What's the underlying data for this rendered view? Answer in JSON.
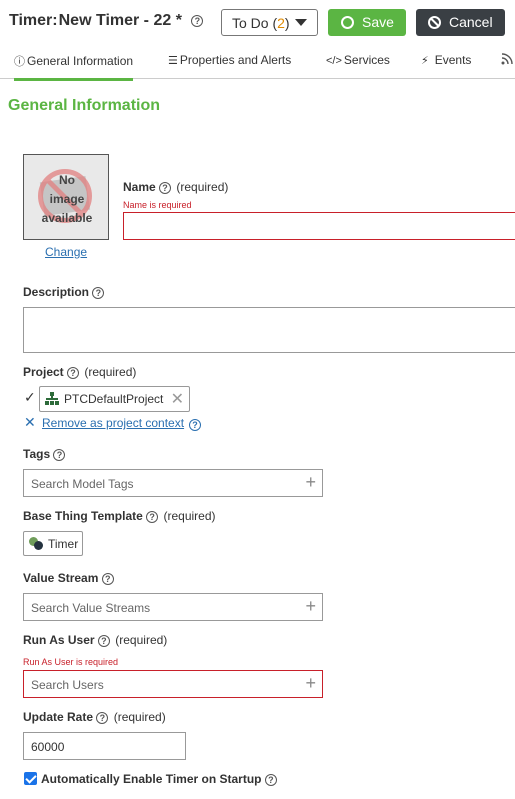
{
  "header": {
    "title_prefix": "Timer:",
    "entity_name": "New Timer - 22",
    "unsaved_marker": "*",
    "todo_label": "To Do (",
    "todo_count": "2",
    "todo_suffix": ")",
    "save_label": "Save",
    "cancel_label": "Cancel"
  },
  "tabs": [
    {
      "label": "General Information",
      "icon": "info-circle-icon",
      "active": true
    },
    {
      "label": "Properties and Alerts",
      "icon": "list-icon"
    },
    {
      "label": "Services",
      "icon": "code-icon"
    },
    {
      "label": "Events",
      "icon": "lightning-icon"
    },
    {
      "label": "",
      "icon": "rss-icon"
    }
  ],
  "section_title": "General Information",
  "image": {
    "placeholder_text_line1": "No",
    "placeholder_text_line2": "image",
    "placeholder_text_line3": "available",
    "change_link": "Change"
  },
  "name": {
    "label": "Name",
    "required": "(required)",
    "error": "Name is required",
    "value": ""
  },
  "description": {
    "label": "Description",
    "value": ""
  },
  "project": {
    "label": "Project",
    "required": "(required)",
    "value": "PTCDefaultProject",
    "remove_link": "Remove as project context"
  },
  "tags": {
    "label": "Tags",
    "placeholder": "Search Model Tags"
  },
  "base_thing_template": {
    "label": "Base Thing Template",
    "required": "(required)",
    "value": "Timer"
  },
  "value_stream": {
    "label": "Value Stream",
    "placeholder": "Search Value Streams"
  },
  "run_as_user": {
    "label": "Run As User",
    "required": "(required)",
    "error": "Run As User is required",
    "placeholder": "Search Users"
  },
  "update_rate": {
    "label": "Update Rate",
    "required": "(required)",
    "value": "60000"
  },
  "auto_enable": {
    "label": "Automatically Enable Timer on Startup",
    "checked": true
  },
  "colors": {
    "accent_green": "#5bb543",
    "error_red": "#c8202a",
    "link_blue": "#2a6fb0",
    "cancel_dark": "#3a3f44",
    "todo_count_orange": "#e08a00"
  }
}
